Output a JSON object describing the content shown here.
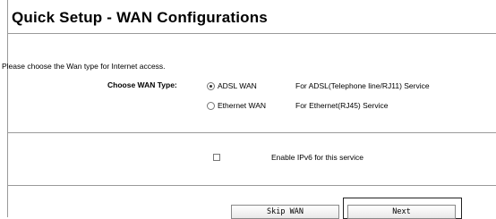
{
  "header": {
    "title": "Quick Setup - WAN Configurations"
  },
  "main": {
    "intro_text": "Please choose the Wan type for Internet access.",
    "wan_type_label": "Choose WAN Type:",
    "options": [
      {
        "label": "ADSL WAN",
        "description": "For ADSL(Telephone line/RJ11) Service",
        "selected": true
      },
      {
        "label": "Ethernet WAN",
        "description": "For Ethernet(RJ45) Service",
        "selected": false
      }
    ],
    "ipv6": {
      "label": "Enable IPv6 for this service",
      "checked": false
    }
  },
  "buttons": {
    "skip_label": "Skip WAN",
    "next_label": "Next"
  }
}
